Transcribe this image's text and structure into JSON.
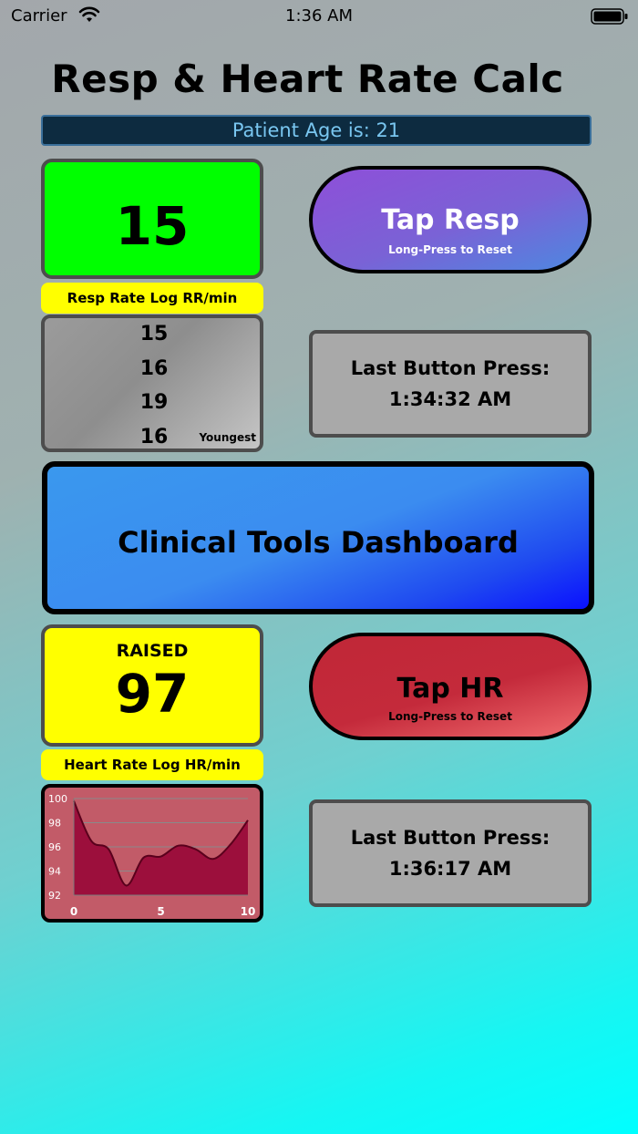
{
  "status_bar": {
    "carrier": "Carrier",
    "time": "1:36 AM"
  },
  "title": "Resp & Heart Rate Calc",
  "patient_age": "Patient Age is: 21",
  "resp": {
    "value": "15",
    "button_label": "Tap Resp",
    "button_sublabel": "Long-Press to Reset",
    "log_label": "Resp Rate Log RR/min",
    "log_values": [
      "15",
      "16",
      "19",
      "16"
    ],
    "log_note": "Youngest",
    "last_press_title": "Last Button Press:",
    "last_press_time": "1:34:32 AM"
  },
  "dashboard": {
    "label": "Clinical Tools Dashboard"
  },
  "hr": {
    "status": "RAISED",
    "value": "97",
    "button_label": "Tap HR",
    "button_sublabel": "Long-Press to Reset",
    "log_label": "Heart Rate Log HR/min",
    "last_press_title": "Last Button Press:",
    "last_press_time": "1:36:17 AM"
  },
  "colors": {
    "resp_tile": "#00ff00",
    "hr_tile": "#ffff00",
    "resp_button": "#8e4fd8",
    "hr_button": "#c02737",
    "dashboard": "#3a98ee"
  },
  "chart_data": {
    "type": "area",
    "x": [
      0,
      1,
      2,
      3,
      4,
      5,
      6,
      7,
      8,
      9,
      10
    ],
    "y": [
      99.8,
      96.5,
      95.8,
      92.8,
      95.1,
      95.2,
      96.1,
      95.8,
      95.0,
      96.2,
      98.2
    ],
    "x_ticks": [
      "0",
      "5",
      "10"
    ],
    "y_ticks": [
      "92",
      "94",
      "96",
      "98",
      "100"
    ],
    "xlim": [
      0,
      10
    ],
    "ylim": [
      92,
      100
    ],
    "grid": true
  }
}
